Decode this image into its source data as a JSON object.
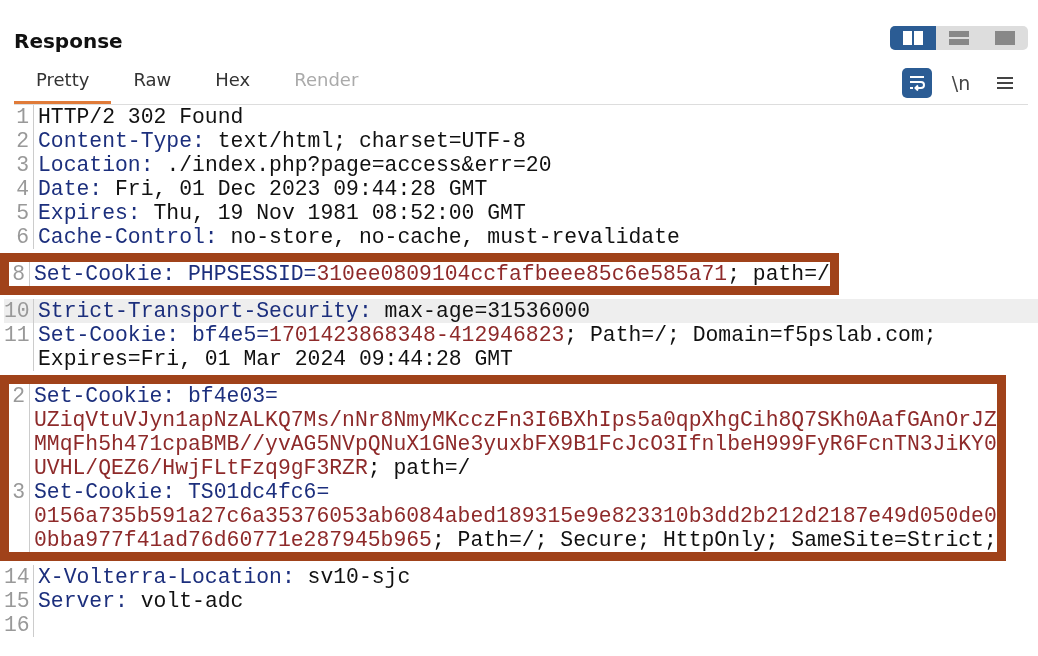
{
  "title": "Response",
  "layout_toggles": [
    {
      "kind": "columns",
      "selected": true
    },
    {
      "kind": "rows",
      "selected": false
    },
    {
      "kind": "single",
      "selected": false
    }
  ],
  "tabs": [
    {
      "label": "Pretty",
      "selected": true,
      "disabled": false
    },
    {
      "label": "Raw",
      "selected": false,
      "disabled": false
    },
    {
      "label": "Hex",
      "selected": false,
      "disabled": false
    },
    {
      "label": "Render",
      "selected": false,
      "disabled": true
    }
  ],
  "tools": [
    {
      "kind": "wrap",
      "on": true
    },
    {
      "kind": "text",
      "label": "\\n",
      "on": false
    },
    {
      "kind": "menu",
      "on": false
    }
  ],
  "blocks": [
    {
      "kind": "plain",
      "rows": [
        {
          "number": "1",
          "current": false,
          "segments": [
            {
              "kind": "plain",
              "text": "HTTP/2 302 Found"
            }
          ]
        },
        {
          "number": "2",
          "current": false,
          "segments": [
            {
              "kind": "name",
              "text": "Content-Type: "
            },
            {
              "kind": "plain",
              "text": "text/html; charset=UTF-8"
            }
          ]
        },
        {
          "number": "3",
          "current": false,
          "segments": [
            {
              "kind": "name",
              "text": "Location: "
            },
            {
              "kind": "plain",
              "text": "./index.php?page=access&err=20"
            }
          ]
        },
        {
          "number": "4",
          "current": false,
          "segments": [
            {
              "kind": "name",
              "text": "Date: "
            },
            {
              "kind": "plain",
              "text": "Fri, 01 Dec 2023 09:44:28 GMT"
            }
          ]
        },
        {
          "number": "5",
          "current": false,
          "segments": [
            {
              "kind": "name",
              "text": "Expires: "
            },
            {
              "kind": "plain",
              "text": "Thu, 19 Nov 1981 08:52:00 GMT"
            }
          ]
        },
        {
          "number": "6",
          "current": false,
          "segments": [
            {
              "kind": "name",
              "text": "Cache-Control: "
            },
            {
              "kind": "plain",
              "text": "no-store, no-cache, must-revalidate"
            }
          ]
        }
      ]
    },
    {
      "kind": "highlight",
      "rows": [
        {
          "number": "8",
          "current": false,
          "segments": [
            {
              "kind": "name",
              "text": "Set-Cookie: PHPSESSID="
            },
            {
              "kind": "value",
              "text": "310ee0809104ccfafbeee85c6e585a71"
            },
            {
              "kind": "plain",
              "text": "; path=/"
            }
          ]
        }
      ]
    },
    {
      "kind": "plain",
      "rows": [
        {
          "number": "10",
          "current": true,
          "segments": [
            {
              "kind": "name",
              "text": "Strict-Transport-Security: "
            },
            {
              "kind": "plain",
              "text": "max-age=31536000"
            }
          ]
        },
        {
          "number": "11",
          "current": false,
          "segments": [
            {
              "kind": "name",
              "text": "Set-Cookie: bf4e5="
            },
            {
              "kind": "value",
              "text": "1701423868348-412946823"
            },
            {
              "kind": "plain",
              "text": "; Path=/; Domain=f5pslab.com;"
            }
          ]
        },
        {
          "current": false,
          "segments": [
            {
              "kind": "plain",
              "text": "Expires=Fri, 01 Mar 2024 09:44:28 GMT"
            }
          ]
        }
      ]
    },
    {
      "kind": "highlight",
      "rows": [
        {
          "number": "2",
          "current": false,
          "segments": [
            {
              "kind": "name",
              "text": "Set-Cookie: bf4e03="
            }
          ]
        },
        {
          "current": false,
          "segments": [
            {
              "kind": "value",
              "text": "UZiqVtuVJyn1apNzALKQ7Ms/nNr8NmyMKcczFn3I6BXhIps5a0qpXhgCih8Q7SKh0AafGAnOrJZ"
            }
          ]
        },
        {
          "current": false,
          "segments": [
            {
              "kind": "value",
              "text": "MMqFh5h471cpaBMB//yvAG5NVpQNuX1GNe3yuxbFX9B1FcJcO3IfnlbeH999FyR6FcnTN3JiKY0"
            }
          ]
        },
        {
          "current": false,
          "segments": [
            {
              "kind": "value",
              "text": "UVHL/QEZ6/HwjFLtFzq9gF3RZR"
            },
            {
              "kind": "plain",
              "text": "; path=/"
            }
          ]
        },
        {
          "number": "3",
          "current": false,
          "segments": [
            {
              "kind": "name",
              "text": "Set-Cookie: TS01dc4fc6="
            }
          ]
        },
        {
          "current": false,
          "segments": [
            {
              "kind": "value",
              "text": "0156a735b591a27c6a35376053ab6084abed189315e9e823310b3dd2b212d2187e49d050de0"
            }
          ]
        },
        {
          "current": false,
          "segments": [
            {
              "kind": "value",
              "text": "0bba977f41ad76d60771e287945b965"
            },
            {
              "kind": "plain",
              "text": "; Path=/; Secure; HttpOnly; SameSite=Strict;"
            }
          ]
        }
      ]
    },
    {
      "kind": "plain",
      "rows": [
        {
          "number": "14",
          "current": false,
          "segments": [
            {
              "kind": "name",
              "text": "X-Volterra-Location: "
            },
            {
              "kind": "plain",
              "text": "sv10-sjc"
            }
          ]
        },
        {
          "number": "15",
          "current": false,
          "segments": [
            {
              "kind": "name",
              "text": "Server: "
            },
            {
              "kind": "plain",
              "text": "volt-adc"
            }
          ]
        },
        {
          "number": "16",
          "current": false,
          "segments": []
        }
      ]
    }
  ]
}
